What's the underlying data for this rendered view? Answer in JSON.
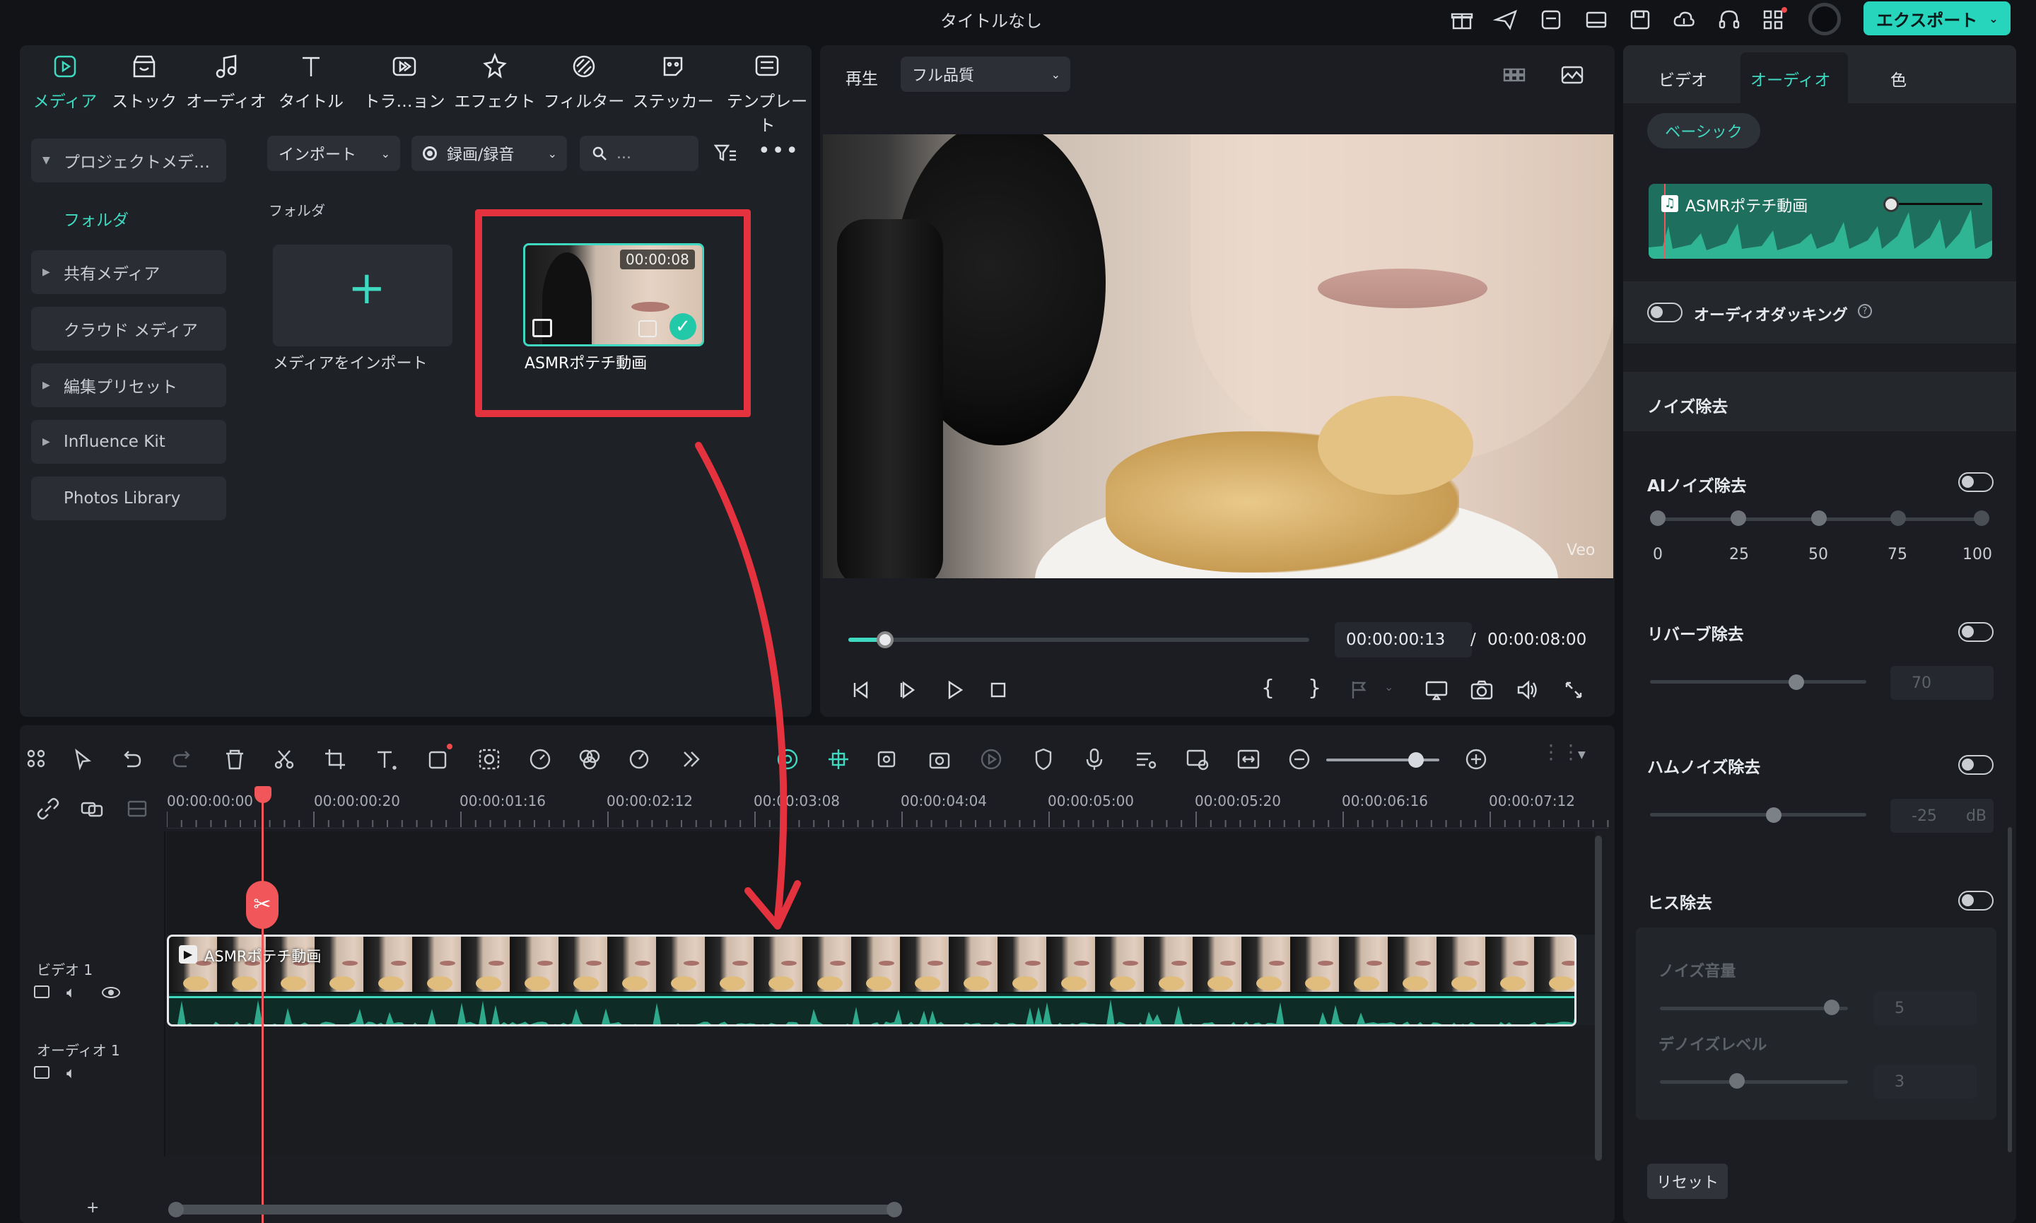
{
  "window": {
    "title": "タイトルなし",
    "export_label": "エクスポート"
  },
  "media_tabs": [
    {
      "label": "メディア",
      "icon": "media-icon"
    },
    {
      "label": "ストック",
      "icon": "stock-icon"
    },
    {
      "label": "オーディオ",
      "icon": "music-icon"
    },
    {
      "label": "タイトル",
      "icon": "title-icon"
    },
    {
      "label": "トラ…ョン",
      "icon": "transition-icon"
    },
    {
      "label": "エフェクト",
      "icon": "effect-icon"
    },
    {
      "label": "フィルター",
      "icon": "filter-icon"
    },
    {
      "label": "ステッカー",
      "icon": "sticker-icon"
    },
    {
      "label": "テンプレート",
      "icon": "template-icon"
    }
  ],
  "sidebar": {
    "items": [
      {
        "label": "プロジェクトメデ…"
      },
      {
        "label": "フォルダ"
      },
      {
        "label": "共有メディア"
      },
      {
        "label": "クラウド メディア"
      },
      {
        "label": "編集プリセット"
      },
      {
        "label": "Influence Kit"
      },
      {
        "label": "Photos Library"
      }
    ]
  },
  "media_toolbar": {
    "import_label": "インポート",
    "record_label": "録画/録音",
    "search_placeholder": "..."
  },
  "media_area": {
    "folder_label": "フォルダ",
    "import_tile_label": "メディアをインポート",
    "clip": {
      "name": "ASMRポテチ動画",
      "duration": "00:00:08"
    }
  },
  "player": {
    "play_label": "再生",
    "quality": "フル品質",
    "watermark": "Veo",
    "current_time": "00:00:00:13",
    "separator": "/",
    "total_time": "00:00:08:00",
    "progress": 0.08
  },
  "right_panel": {
    "tabs": [
      "ビデオ",
      "オーディオ",
      "色"
    ],
    "active_tab": "オーディオ",
    "basic_label": "ベーシック",
    "audio_clip_name": "ASMRポテチ動画",
    "ducking_label": "オーディオダッキング",
    "noise_section": "ノイズ除去",
    "ai_noise_label": "AIノイズ除去",
    "ai_ticks": [
      "0",
      "25",
      "50",
      "75",
      "100"
    ],
    "reverb_label": "リバーブ除去",
    "reverb_value": "70",
    "hum_label": "ハムノイズ除去",
    "hum_value": "-25",
    "hum_unit": "dB",
    "hiss_label": "ヒス除去",
    "noise_volume_label": "ノイズ音量",
    "noise_volume_value": "5",
    "denoise_level_label": "デノイズレベル",
    "denoise_level_value": "3",
    "reset_label": "リセット"
  },
  "timeline": {
    "ticks": [
      "00:00:00:00",
      "00:00:00:20",
      "00:00:01:16",
      "00:00:02:12",
      "00:00:03:08",
      "00:00:04:04",
      "00:00:05:00",
      "00:00:05:20",
      "00:00:06:16",
      "00:00:07:12"
    ],
    "video_track_label": "ビデオ 1",
    "audio_track_label": "オーディオ 1",
    "clip_label": "ASMRポテチ動画",
    "add_track": "+"
  },
  "colors": {
    "accent": "#3ed9c0",
    "highlight": "#e5323f",
    "playhead": "#f0565a"
  }
}
